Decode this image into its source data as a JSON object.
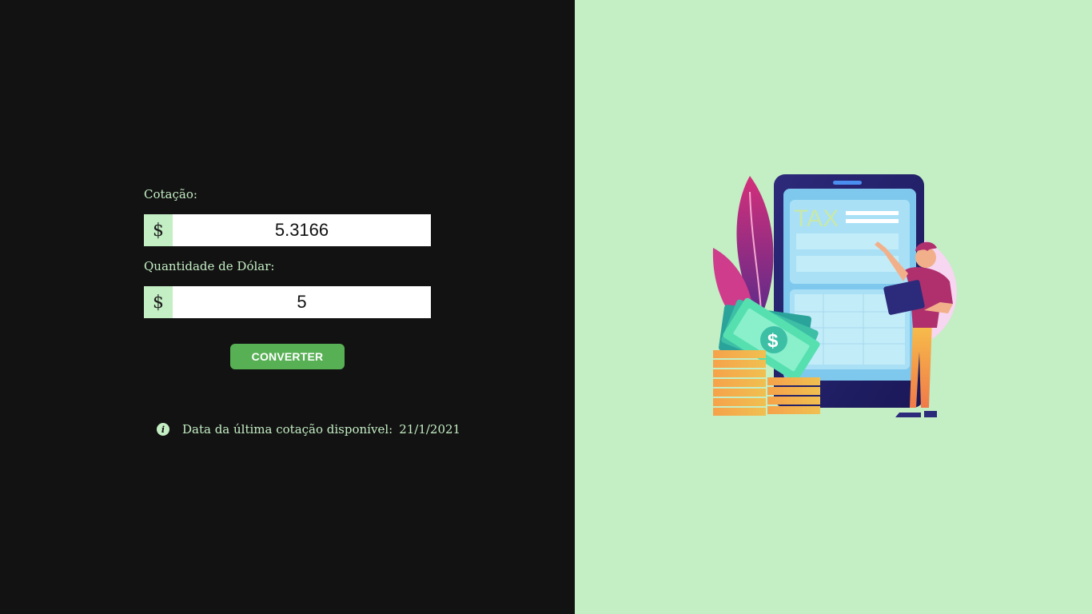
{
  "form": {
    "quote_label": "Cotação:",
    "quote_prefix": "$",
    "quote_value": "5.3166",
    "amount_label": "Quantidade de Dólar:",
    "amount_prefix": "$",
    "amount_value": "5",
    "convert_button": "CONVERTER"
  },
  "info": {
    "icon": "info-icon",
    "text": "Data da última cotação disponível:",
    "date": "21/1/2021"
  },
  "illustration": {
    "tax_text": "TAX",
    "coin_symbol": "$"
  },
  "colors": {
    "left_bg": "#121212",
    "right_bg": "#c4eec4",
    "accent": "#58b054"
  }
}
